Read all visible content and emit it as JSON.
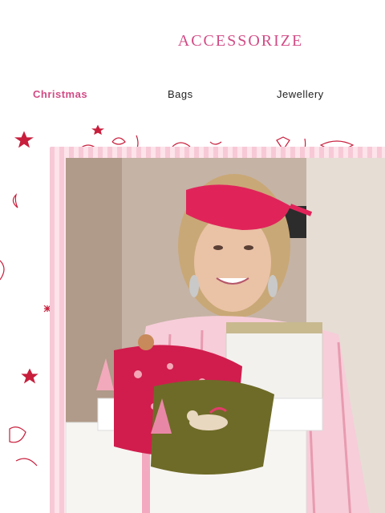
{
  "brand": {
    "name": "ACCESSORIZE"
  },
  "nav": {
    "items": [
      {
        "label": "Christmas",
        "active": true
      },
      {
        "label": "Bags",
        "active": false
      },
      {
        "label": "Jewellery",
        "active": false
      }
    ]
  },
  "hero": {
    "image_alt": "Woman in pink pyjamas with pink sleep mask holding gift boxes and velvet pouches",
    "colors": {
      "frame_pink": "#f7c9d6",
      "doodle_red": "#c81e3c",
      "mask_pink": "#e0245a",
      "pouch_red": "#d01d4d",
      "pouch_olive": "#6e6b28"
    }
  }
}
